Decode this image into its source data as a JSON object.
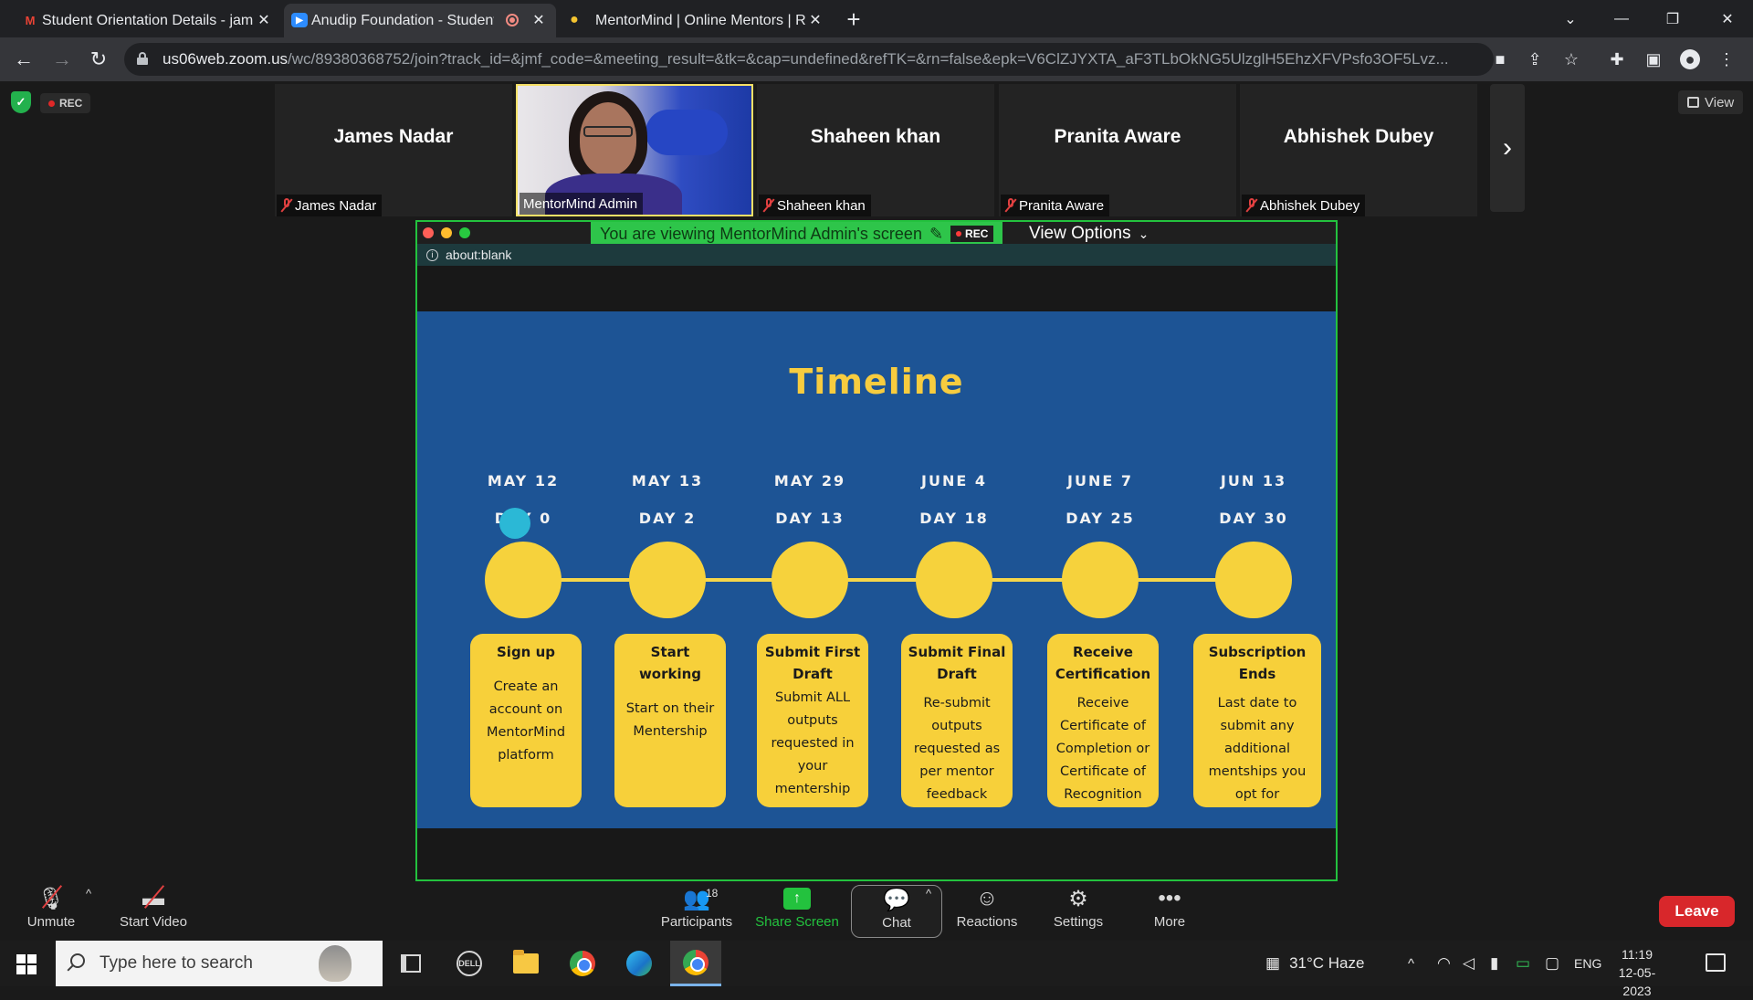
{
  "browser": {
    "tabs": [
      {
        "title": "Student Orientation Details - jam",
        "icon": "gmail-icon",
        "active": false
      },
      {
        "title": "Anudip Foundation - Student",
        "icon": "zoom-icon",
        "active": true
      },
      {
        "title": "MentorMind | Online Mentors | R",
        "icon": "mentormind-icon",
        "active": false
      }
    ],
    "url_host": "us06web.zoom.us",
    "url_path": "/wc/89380368752/join?track_id=&jmf_code=&meeting_result=&tk=&cap=undefined&refTK=&rn=false&epk=V6ClZJYXTA_aF3TLbOkNG5UlzglH5EhzXFVPsfo3OF5Lvz..."
  },
  "meeting": {
    "rec_label": "REC",
    "view_label": "View",
    "participants": [
      {
        "big_name": "James Nadar",
        "label": "James Nadar",
        "muted": true,
        "video": false
      },
      {
        "big_name": "",
        "label": "MentorMind Admin",
        "muted": false,
        "video": true
      },
      {
        "big_name": "Shaheen khan",
        "label": "Shaheen khan",
        "muted": true,
        "video": false
      },
      {
        "big_name": "Pranita Aware",
        "label": "Pranita Aware",
        "muted": true,
        "video": false
      },
      {
        "big_name": "Abhishek Dubey",
        "label": "Abhishek Dubey",
        "muted": true,
        "video": false
      }
    ],
    "share_banner": "You are viewing MentorMind Admin's screen",
    "share_rec": "REC",
    "view_options": "View Options",
    "inner_url": "about:blank"
  },
  "slide": {
    "title": "Timeline",
    "items": [
      {
        "date": "MAY  12",
        "day": "DAY 0",
        "head": "Sign up",
        "body": "Create an account on MentorMind platform"
      },
      {
        "date": "MAY 13",
        "day": "DAY 2",
        "head": "Start working",
        "body": "Start on their Mentership"
      },
      {
        "date": "MAY 29",
        "day": "DAY 13",
        "head": "Submit First Draft",
        "body": "Submit ALL outputs requested in your mentership"
      },
      {
        "date": "JUNE 4",
        "day": "DAY 18",
        "head": "Submit Final Draft",
        "body": "Re-submit outputs requested as per mentor feedback"
      },
      {
        "date": "JUNE 7",
        "day": "DAY 25",
        "head": "Receive Certification",
        "body": "Receive Certificate of Completion or Certificate of Recognition"
      },
      {
        "date": "JUN 13",
        "day": "DAY 30",
        "head": "Subscription Ends",
        "body": "Last date to submit any additional mentships you opt for"
      }
    ]
  },
  "toolbar": {
    "unmute": "Unmute",
    "start_video": "Start Video",
    "participants": "Participants",
    "participants_count": "18",
    "share_screen": "Share Screen",
    "chat": "Chat",
    "reactions": "Reactions",
    "settings": "Settings",
    "more": "More",
    "leave": "Leave"
  },
  "taskbar": {
    "search_placeholder": "Type here to search",
    "weather": "31°C  Haze",
    "lang": "ENG",
    "time": "11:19",
    "date": "12-05-2023"
  }
}
